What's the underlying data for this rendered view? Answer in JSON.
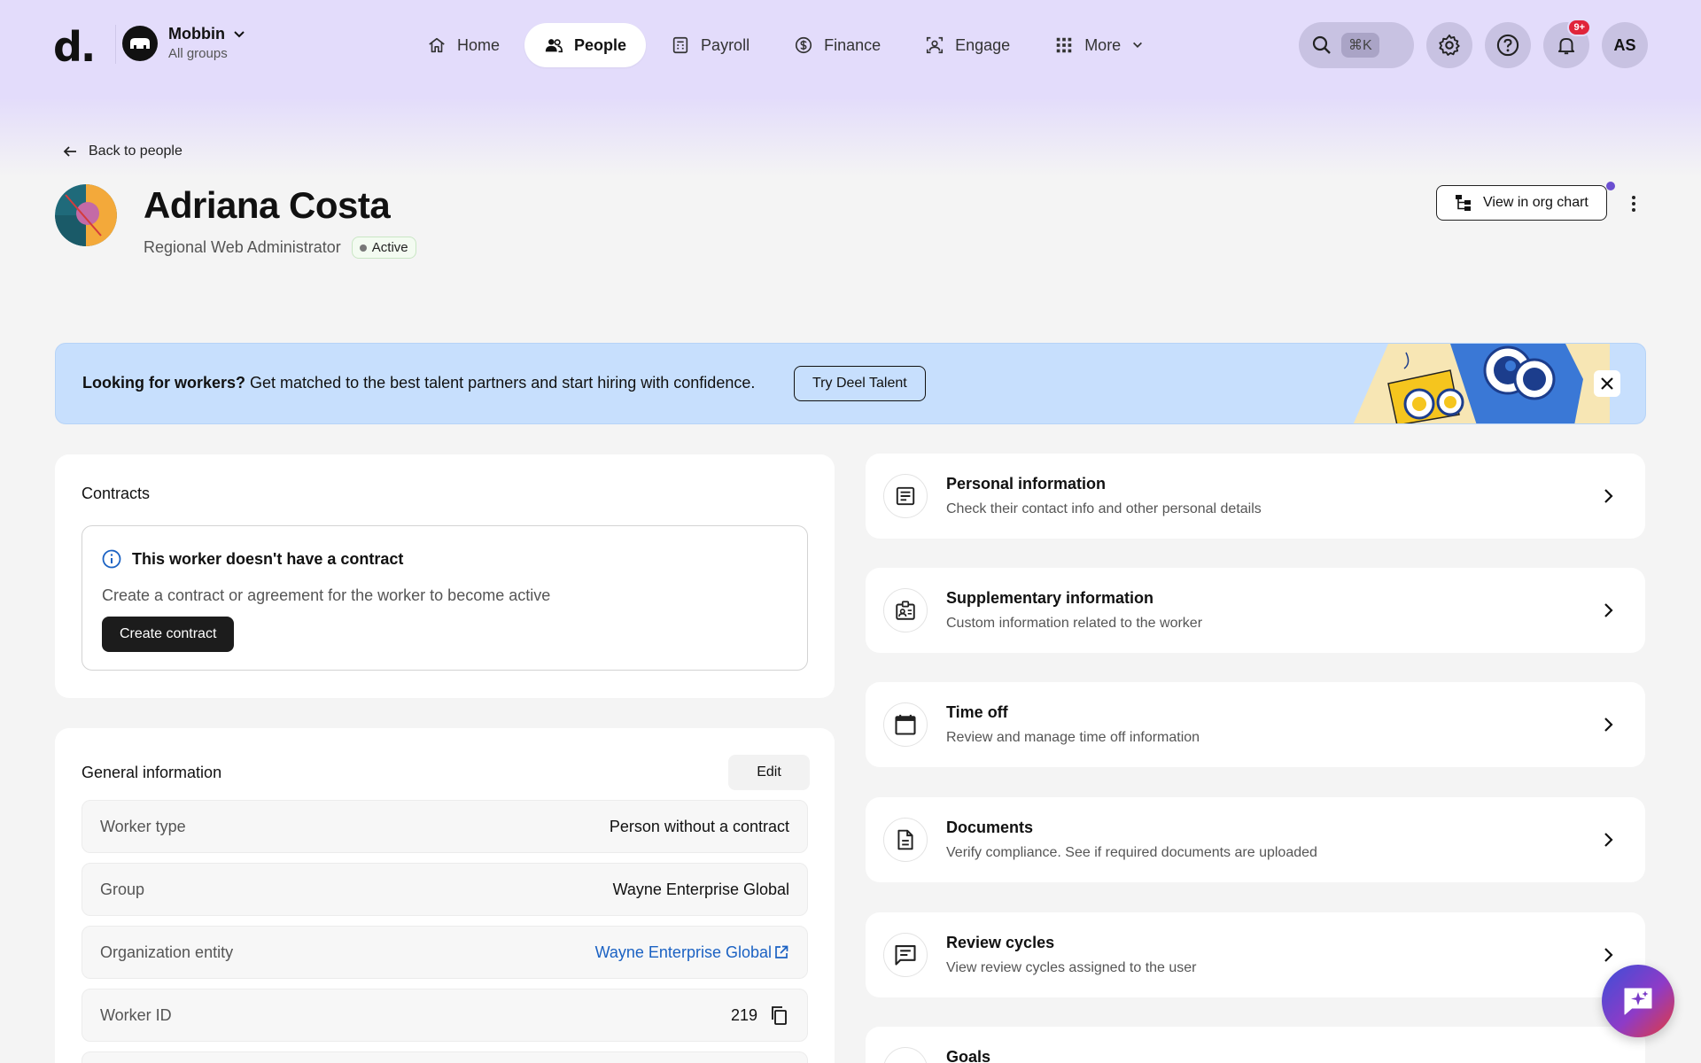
{
  "app": {
    "logo_text": "d.",
    "org_name": "Mobbin",
    "org_sub": "All groups"
  },
  "nav": {
    "items": [
      {
        "label": "Home",
        "icon": "home-icon"
      },
      {
        "label": "People",
        "icon": "people-icon",
        "active": true
      },
      {
        "label": "Payroll",
        "icon": "calculator-icon"
      },
      {
        "label": "Finance",
        "icon": "dollar-icon"
      },
      {
        "label": "Engage",
        "icon": "engage-icon"
      },
      {
        "label": "More",
        "icon": "grid-icon"
      }
    ]
  },
  "tools": {
    "search_shortcut": "⌘K",
    "notifications_count": "9+",
    "user_initials": "AS"
  },
  "header": {
    "back_label": "Back to people",
    "name": "Adriana Costa",
    "role": "Regional Web Administrator",
    "status": "Active",
    "org_chart_label": "View in org chart"
  },
  "banner": {
    "bold": "Looking for workers?",
    "text": " Get matched to the best talent partners and start hiring with confidence.",
    "button": "Try Deel Talent"
  },
  "contracts": {
    "title": "Contracts",
    "alert_title": "This worker doesn't have a contract",
    "alert_desc": "Create a contract or agreement for the worker to become active",
    "button": "Create contract"
  },
  "general": {
    "title": "General information",
    "edit_label": "Edit",
    "rows": [
      {
        "label": "Worker type",
        "value": "Person without a contract"
      },
      {
        "label": "Group",
        "value": "Wayne Enterprise Global"
      },
      {
        "label": "Organization entity",
        "value": "Wayne Enterprise Global"
      },
      {
        "label": "Worker ID",
        "value": "219"
      }
    ]
  },
  "sections": [
    {
      "title": "Personal information",
      "sub": "Check their contact info and other personal details",
      "icon": "document-lines-icon"
    },
    {
      "title": "Supplementary information",
      "sub": "Custom information related to the worker",
      "icon": "id-badge-icon"
    },
    {
      "title": "Time off",
      "sub": "Review and manage time off information",
      "icon": "calendar-icon"
    },
    {
      "title": "Documents",
      "sub": "Verify compliance. See if required documents are uploaded",
      "icon": "file-icon"
    },
    {
      "title": "Review cycles",
      "sub": "View review cycles assigned to the user",
      "icon": "chat-bubble-icon"
    },
    {
      "title": "Goals",
      "sub": "",
      "icon": "goals-icon"
    }
  ],
  "colors": {
    "nav_bg": "#e3dcfb",
    "banner_bg": "#c7dffd",
    "link": "#1b62c3",
    "badge_red": "#e0243a"
  }
}
